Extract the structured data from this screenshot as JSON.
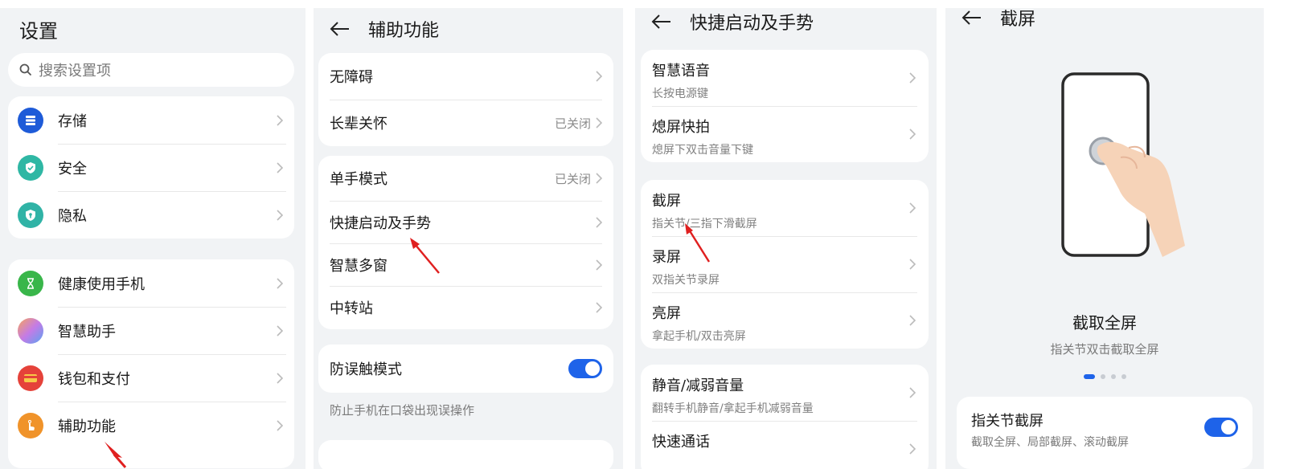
{
  "panel1": {
    "title": "设置",
    "search_placeholder": "搜索设置项",
    "group1": [
      {
        "label": "存储",
        "icon": "storage-icon",
        "color": "#1e5bd8"
      },
      {
        "label": "安全",
        "icon": "shield-icon",
        "color": "#2fb7a4"
      },
      {
        "label": "隐私",
        "icon": "privacy-shield-icon",
        "color": "#30b3a6"
      }
    ],
    "group2": [
      {
        "label": "健康使用手机",
        "icon": "hourglass-icon",
        "color": "#39b64a"
      },
      {
        "label": "智慧助手",
        "icon": "assistant-icon",
        "color": "#c47be6"
      },
      {
        "label": "钱包和支付",
        "icon": "wallet-icon",
        "color": "#e5423a"
      },
      {
        "label": "辅助功能",
        "icon": "hand-icon",
        "color": "#f0932a"
      }
    ]
  },
  "panel2": {
    "title": "辅助功能",
    "group1": [
      {
        "label": "无障碍",
        "value": ""
      },
      {
        "label": "长辈关怀",
        "value": "已关闭"
      }
    ],
    "group2": [
      {
        "label": "单手模式",
        "value": "已关闭"
      },
      {
        "label": "快捷启动及手势",
        "value": ""
      },
      {
        "label": "智慧多窗",
        "value": ""
      },
      {
        "label": "中转站",
        "value": ""
      }
    ],
    "mistouch_label": "防误触模式",
    "mistouch_on": true,
    "mistouch_desc": "防止手机在口袋出现误操作"
  },
  "panel3": {
    "title": "快捷启动及手势",
    "group1": [
      {
        "title": "智慧语音",
        "sub": "长按电源键"
      },
      {
        "title": "熄屏快拍",
        "sub": "熄屏下双击音量下键"
      }
    ],
    "group2": [
      {
        "title": "截屏",
        "sub": "指关节/三指下滑截屏"
      },
      {
        "title": "录屏",
        "sub": "双指关节录屏"
      },
      {
        "title": "亮屏",
        "sub": "拿起手机/双击亮屏"
      }
    ],
    "group3": [
      {
        "title": "静音/减弱音量",
        "sub": "翻转手机静音/拿起手机减弱音量"
      },
      {
        "title": "快速通话",
        "sub": ""
      }
    ]
  },
  "panel4": {
    "title": "截屏",
    "caption_title": "截取全屏",
    "caption_sub": "指关节双击截取全屏",
    "page_dots": 4,
    "active_dot": 1,
    "knuckle_label": "指关节截屏",
    "knuckle_sub": "截取全屏、局部截屏、滚动截屏",
    "knuckle_on": true
  }
}
